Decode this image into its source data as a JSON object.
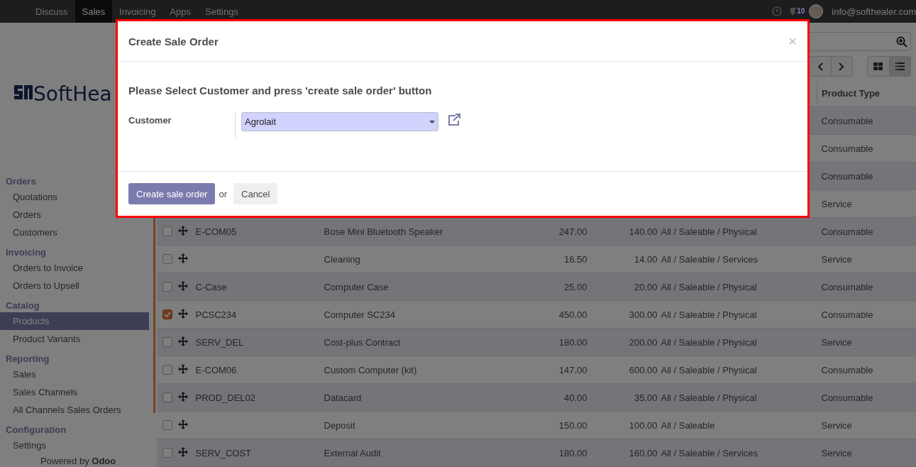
{
  "navbar": {
    "apps": [
      {
        "label": "Discuss",
        "selected": false
      },
      {
        "label": "Sales",
        "selected": true
      },
      {
        "label": "Invoicing",
        "selected": false
      },
      {
        "label": "Apps",
        "selected": false
      },
      {
        "label": "Settings",
        "selected": false
      }
    ],
    "chat_count": "10",
    "user": "info@softhealer.com"
  },
  "sidebar": {
    "logo_text": "SoftHea",
    "sections": [
      {
        "title": "Orders",
        "items": [
          {
            "label": "Quotations",
            "selected": false
          },
          {
            "label": "Orders",
            "selected": false
          },
          {
            "label": "Customers",
            "selected": false
          }
        ]
      },
      {
        "title": "Invoicing",
        "items": [
          {
            "label": "Orders to Invoice",
            "selected": false
          },
          {
            "label": "Orders to Upsell",
            "selected": false
          }
        ]
      },
      {
        "title": "Catalog",
        "items": [
          {
            "label": "Products",
            "selected": true
          },
          {
            "label": "Product Variants",
            "selected": false
          }
        ]
      },
      {
        "title": "Reporting",
        "items": [
          {
            "label": "Sales",
            "selected": false
          },
          {
            "label": "Sales Channels",
            "selected": false
          },
          {
            "label": "All Channels Sales Orders",
            "selected": false
          }
        ]
      },
      {
        "title": "Configuration",
        "items": [
          {
            "label": "Settings",
            "selected": false
          }
        ]
      }
    ],
    "footer": "Powered by **Odoo**"
  },
  "control_panel": {
    "views": [
      {
        "kind": "kanban",
        "selected": false
      },
      {
        "kind": "list",
        "selected": true
      }
    ]
  },
  "table": {
    "header": {
      "product_type": "Product Type"
    },
    "rows": [
      {
        "product_type": "Consumable"
      },
      {
        "product_type": "Consumable"
      },
      {
        "product_type": "Consumable"
      },
      {
        "product_type": "Service"
      },
      {
        "checked": false,
        "reference": "E-COM05",
        "name": "Bose Mini Bluetooth Speaker",
        "sales_price": "247.00",
        "cost": "140.00",
        "category": "All / Saleable / Physical",
        "product_type": "Consumable"
      },
      {
        "checked": false,
        "name": "Cleaning",
        "sales_price": "16.50",
        "cost": "14.00",
        "category": "All / Saleable / Services",
        "product_type": "Service"
      },
      {
        "checked": false,
        "reference": "C-Case",
        "name": "Computer Case",
        "sales_price": "25.00",
        "cost": "20.00",
        "category": "All / Saleable / Physical",
        "product_type": "Consumable"
      },
      {
        "checked": true,
        "reference": "PCSC234",
        "name": "Computer SC234",
        "sales_price": "450.00",
        "cost": "300.00",
        "category": "All / Saleable / Physical",
        "product_type": "Consumable"
      },
      {
        "checked": false,
        "reference": "SERV_DEL",
        "name": "Cost-plus Contract",
        "sales_price": "180.00",
        "cost": "200.00",
        "category": "All / Saleable / Physical",
        "product_type": "Service"
      },
      {
        "checked": false,
        "reference": "E-COM06",
        "name": "Custom Computer (kit)",
        "sales_price": "147.00",
        "cost": "600.00",
        "category": "All / Saleable / Physical",
        "product_type": "Consumable"
      },
      {
        "checked": false,
        "reference": "PROD_DEL02",
        "name": "Datacard",
        "sales_price": "40.00",
        "cost": "35.00",
        "category": "All / Saleable / Physical",
        "product_type": "Consumable"
      },
      {
        "checked": false,
        "name": "Deposit",
        "sales_price": "150.00",
        "cost": "100.00",
        "category": "All / Saleable",
        "product_type": "Service"
      },
      {
        "checked": false,
        "reference": "SERV_COST",
        "name": "External Audit",
        "sales_price": "180.00",
        "cost": "160.00",
        "category": "All / Saleable / Services",
        "product_type": "Service"
      }
    ]
  },
  "dialog": {
    "title": "Create Sale Order",
    "close": "×",
    "message": "Please Select Customer and press 'create sale order' button",
    "fields": [
      {
        "label": "Customer",
        "value": "Agrolait"
      }
    ],
    "primary_button": "Create sale order",
    "separator": "or",
    "secondary_button": "Cancel"
  }
}
